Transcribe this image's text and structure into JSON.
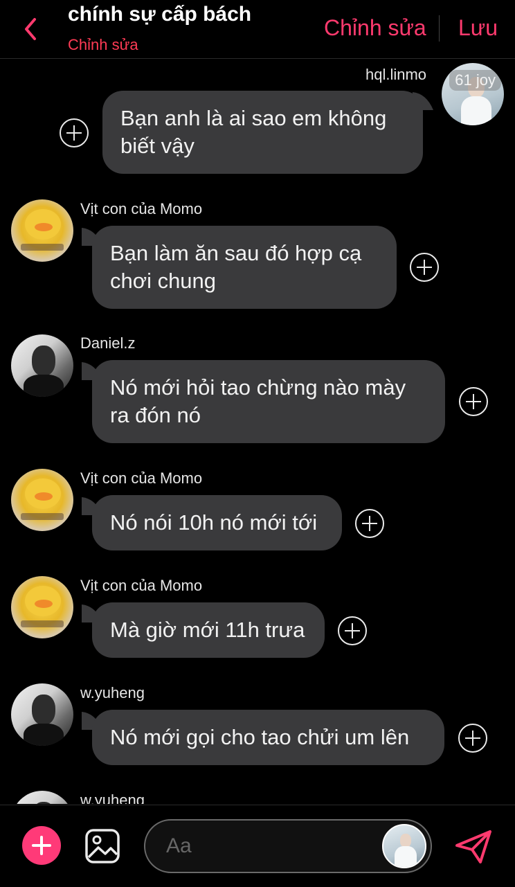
{
  "header": {
    "title": "chính sự cấp bách",
    "subtitle": "Chỉnh sửa",
    "edit_label": "Chỉnh sửa",
    "save_label": "Lưu"
  },
  "messages": [
    {
      "sender": "hql.linmo",
      "text": "Bạn anh là ai sao em không biết vậy",
      "side": "right",
      "avatar_badge": "61 joy"
    },
    {
      "sender": "Vịt con của Momo",
      "text": "Bạn làm ăn sau đó hợp cạ chơi chung",
      "side": "left"
    },
    {
      "sender": "Daniel.z",
      "text": "Nó mới hỏi tao chừng nào mày ra đón nó",
      "side": "left"
    },
    {
      "sender": "Vịt con của Momo",
      "text": "Nó nói 10h nó mới tới",
      "side": "left"
    },
    {
      "sender": "Vịt con của Momo",
      "text": "Mà giờ mới 11h trưa",
      "side": "left"
    },
    {
      "sender": "w.yuheng",
      "text": "Nó mới gọi cho tao chửi um lên",
      "side": "left"
    },
    {
      "sender": "w.yuheng",
      "text": "",
      "side": "left"
    }
  ],
  "composer": {
    "placeholder": "Aa"
  },
  "colors": {
    "accent": "#ff3a6e",
    "bubble": "#3a3a3c",
    "background": "#000000"
  },
  "icons": {
    "back": "chevron-left-icon",
    "add": "plus-icon",
    "gallery": "image-icon",
    "send": "send-icon",
    "react": "add-reaction-icon"
  }
}
